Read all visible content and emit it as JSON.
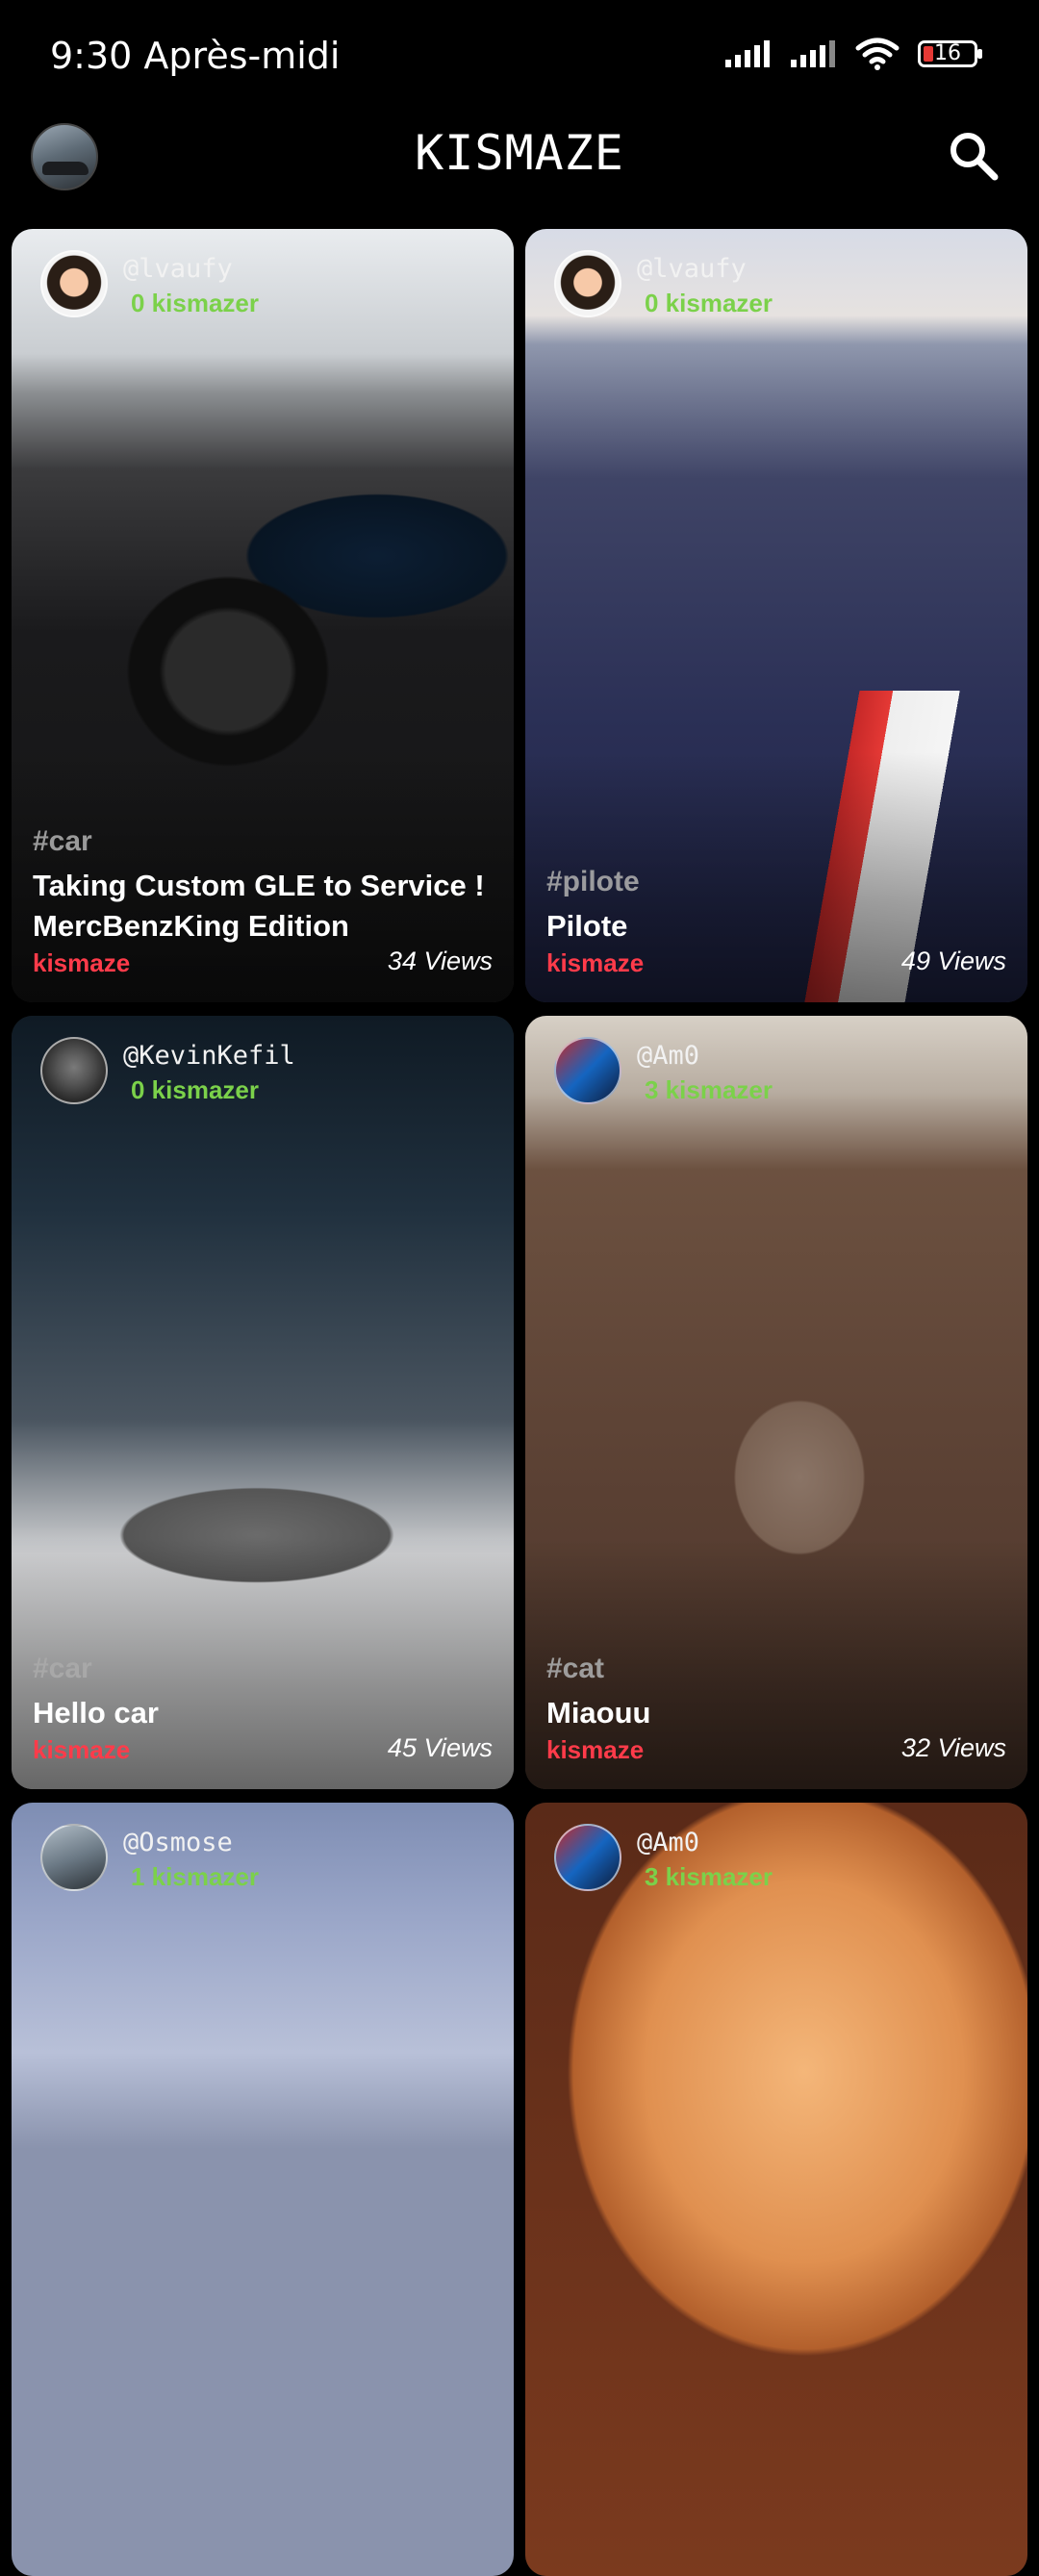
{
  "status_bar": {
    "time": "9:30 Après-midi",
    "battery": "16",
    "battery_color": "#e53935"
  },
  "header": {
    "title": "KISMAZE",
    "search_icon": "search-icon",
    "avatar_icon": "profile-avatar"
  },
  "colors": {
    "points": "#7bd14a",
    "source": "#ff3b4a",
    "background": "#000000"
  },
  "cards": [
    {
      "author": "@lvaufy",
      "points": "0 kismazer",
      "tag": "#car",
      "title": "Taking Custom GLE to Service ! MercBenzKing Edition",
      "source": "kismaze",
      "views": "34 Views"
    },
    {
      "author": "@lvaufy",
      "points": "0 kismazer",
      "tag": "#pilote",
      "title": "Pilote",
      "source": "kismaze",
      "views": "49 Views"
    },
    {
      "author": "@KevinKefil",
      "points": "0 kismazer",
      "tag": "#car",
      "title": "Hello car",
      "source": "kismaze",
      "views": "45 Views"
    },
    {
      "author": "@Am0",
      "points": "3 kismazer",
      "tag": "#cat",
      "title": "Miaouu",
      "source": "kismaze",
      "views": "32 Views"
    },
    {
      "author": "@Osmose",
      "points": "1 kismazer"
    },
    {
      "author": "@Am0",
      "points": "3 kismazer"
    }
  ]
}
